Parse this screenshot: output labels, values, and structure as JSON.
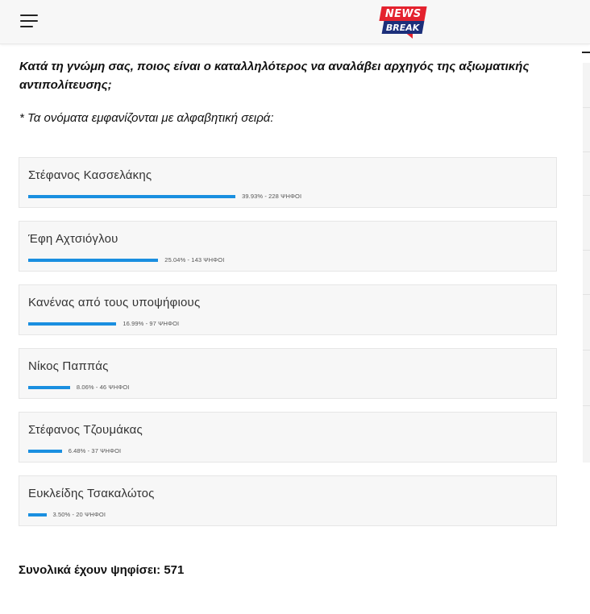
{
  "header": {
    "menu_icon": "hamburger-menu-icon",
    "logo": {
      "line1": "NEWS",
      "line2": "BREAK",
      "colors": {
        "red": "#e4222e",
        "blue": "#1c2f7a"
      }
    }
  },
  "poll": {
    "question": "Κατά τη γνώμη σας, ποιος είναι ο καταλληλότερος να αναλάβει αρχηγός της αξιωματικής αντιπολίτευσης;",
    "note": "* Τα ονόματα εμφανίζονται με αλφαβητική σειρά:",
    "bar_color": "#1a8fe0",
    "options": [
      {
        "name": "Στέφανος Κασσελάκης",
        "percent": 39.93,
        "stat": "39.93% - 228 ΨΗΦΟΙ"
      },
      {
        "name": "Έφη Αχτσιόγλου",
        "percent": 25.04,
        "stat": "25.04% - 143 ΨΗΦΟΙ"
      },
      {
        "name": "Κανένας από τους υποψήφιους",
        "percent": 16.99,
        "stat": "16.99% - 97 ΨΗΦΟΙ"
      },
      {
        "name": "Νίκος Παππάς",
        "percent": 8.06,
        "stat": "8.06% - 46 ΨΗΦΟΙ"
      },
      {
        "name": "Στέφανος Τζουμάκας",
        "percent": 6.48,
        "stat": "6.48% - 37 ΨΗΦΟΙ"
      },
      {
        "name": "Ευκλείδης Τσακαλώτος",
        "percent": 3.5,
        "stat": "3.50% - 20 ΨΗΦΟΙ"
      }
    ],
    "total_label": "Συνολικά έχουν ψηφίσει: 571"
  }
}
